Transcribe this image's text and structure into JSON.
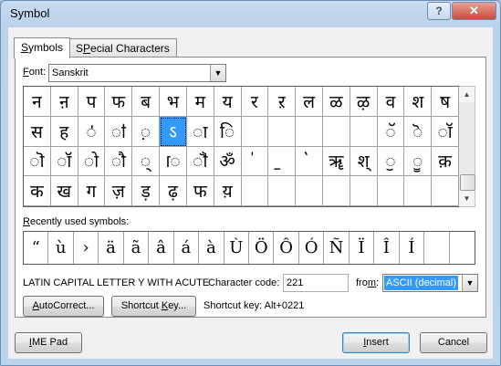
{
  "window": {
    "title": "Symbol",
    "help": "?",
    "close": "✕"
  },
  "tabs": [
    {
      "label": "Symbols",
      "accel": "S",
      "rest": "ymbols"
    },
    {
      "label": "Special Characters",
      "accel": "P",
      "pre": "S",
      "rest": "ecial Characters"
    }
  ],
  "font": {
    "label_accel": "F",
    "label_rest": "ont:",
    "value": "Sanskrit"
  },
  "grid": {
    "rows": [
      [
        "न",
        "ऩ",
        "प",
        "फ",
        "ब",
        "भ",
        "म",
        "य",
        "र",
        "ऱ",
        "ल",
        "ळ",
        "ऴ",
        "व",
        "श",
        "ष"
      ],
      [
        "स",
        "ह",
        "ऺ",
        "ऻ",
        "़",
        "ऽ",
        "ा",
        "ि",
        "",
        "",
        "",
        "",
        "",
        "ॅ",
        "ॆ",
        "ॉ"
      ],
      [
        "ॊ",
        "ॉ",
        "ो",
        "ौ",
        "्",
        "ॎ",
        "ॏ",
        "ॐ",
        "॑",
        "॒",
        "॓",
        "ॠ",
        "श्",
        "ॖ",
        "ॗ",
        "क़"
      ],
      [
        "क",
        "ख",
        "ग",
        "ज़",
        "ड़",
        "ढ़",
        "फ",
        "य़",
        "",
        "",
        "",
        "",
        "",
        "",
        "",
        ""
      ]
    ],
    "selected": [
      1,
      5
    ],
    "selected_glyph": "ऽ"
  },
  "recent": {
    "label_accel": "R",
    "label_rest": "ecently used symbols:",
    "symbols": [
      "“",
      "ù",
      "›",
      "ä",
      "ã",
      "â",
      "á",
      "à",
      "Ù",
      "Ö",
      "Ô",
      "Ó",
      "Ñ",
      "Ï",
      "Î",
      "Í",
      "",
      ""
    ]
  },
  "char_name": "LATIN CAPITAL LETTER Y WITH ACUTE",
  "char_code": {
    "label": "Character code:",
    "value": "221"
  },
  "from": {
    "label_accel": "m",
    "label_pre": "fro",
    "label_rest": ":",
    "value": "ASCII (decimal)"
  },
  "buttons": {
    "autocorrect": {
      "accel": "A",
      "rest": "utoCorrect..."
    },
    "shortcut": {
      "pre": "Shortcut ",
      "accel": "K",
      "rest": "ey..."
    },
    "ime_pad": {
      "accel": "I",
      "rest": "ME Pad"
    },
    "insert": {
      "accel": "I",
      "rest": "nsert"
    },
    "cancel": "Cancel"
  },
  "shortcut_text": "Shortcut key: Alt+0221"
}
